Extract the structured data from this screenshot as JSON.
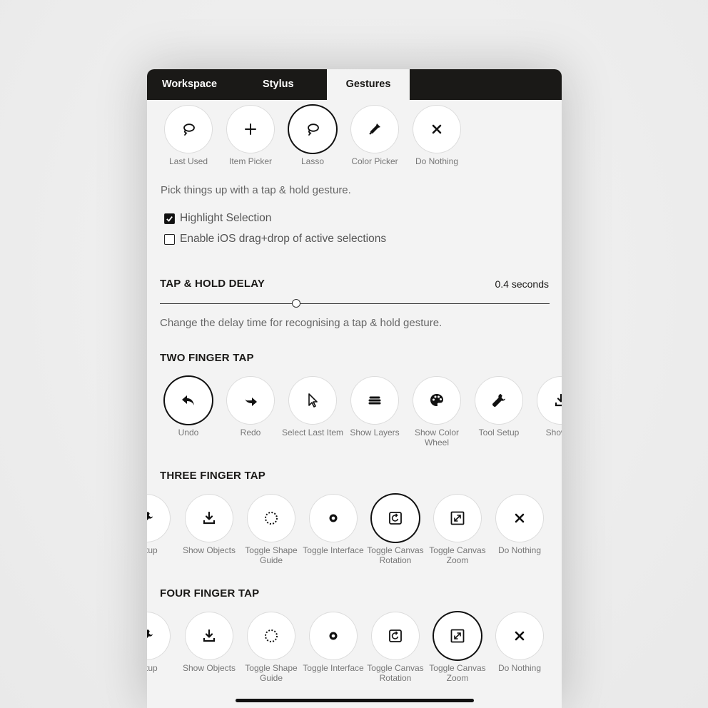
{
  "tabs": [
    "Workspace",
    "Stylus",
    "Gestures"
  ],
  "active_tab": "Gestures",
  "top_options": [
    {
      "label": "Last Used",
      "icon": "lasso-icon",
      "selected": false
    },
    {
      "label": "Item Picker",
      "icon": "plus-icon",
      "selected": false
    },
    {
      "label": "Lasso",
      "icon": "lasso-icon",
      "selected": true
    },
    {
      "label": "Color Picker",
      "icon": "eyedropper-icon",
      "selected": false
    },
    {
      "label": "Do Nothing",
      "icon": "x-icon",
      "selected": false
    }
  ],
  "pick_description": "Pick things up with a tap & hold gesture.",
  "checkboxes": [
    {
      "label": "Highlight Selection",
      "checked": true
    },
    {
      "label": "Enable iOS drag+drop of active selections",
      "checked": false
    }
  ],
  "delay": {
    "title": "TAP & HOLD DELAY",
    "value_text": "0.4 seconds",
    "slider_fraction": 0.35,
    "description": "Change the delay time for recognising a tap & hold gesture."
  },
  "two_finger": {
    "title": "TWO FINGER TAP",
    "options": [
      {
        "label": "Undo",
        "icon": "undo-icon",
        "selected": true
      },
      {
        "label": "Redo",
        "icon": "redo-icon",
        "selected": false
      },
      {
        "label": "Select Last Item",
        "icon": "cursor-icon",
        "selected": false
      },
      {
        "label": "Show Layers",
        "icon": "layers-icon",
        "selected": false
      },
      {
        "label": "Show Color Wheel",
        "icon": "palette-icon",
        "selected": false
      },
      {
        "label": "Tool Setup",
        "icon": "wrench-icon",
        "selected": false
      },
      {
        "label": "Show O",
        "icon": "download-icon",
        "selected": false
      }
    ]
  },
  "three_finger": {
    "title": "THREE FINGER TAP",
    "options": [
      {
        "label": "Setup",
        "icon": "wrench-icon",
        "selected": false
      },
      {
        "label": "Show Objects",
        "icon": "download-icon",
        "selected": false
      },
      {
        "label": "Toggle Shape Guide",
        "icon": "dotted-circle-icon",
        "selected": false
      },
      {
        "label": "Toggle Interface",
        "icon": "dot-icon",
        "selected": false
      },
      {
        "label": "Toggle Canvas Rotation",
        "icon": "rotate-icon",
        "selected": true
      },
      {
        "label": "Toggle Canvas Zoom",
        "icon": "zoom-icon",
        "selected": false
      },
      {
        "label": "Do Nothing",
        "icon": "x-icon",
        "selected": false
      }
    ]
  },
  "four_finger": {
    "title": "FOUR FINGER TAP",
    "options": [
      {
        "label": "Setup",
        "icon": "wrench-icon",
        "selected": false
      },
      {
        "label": "Show Objects",
        "icon": "download-icon",
        "selected": false
      },
      {
        "label": "Toggle Shape Guide",
        "icon": "dotted-circle-icon",
        "selected": false
      },
      {
        "label": "Toggle Interface",
        "icon": "dot-icon",
        "selected": false
      },
      {
        "label": "Toggle Canvas Rotation",
        "icon": "rotate-icon",
        "selected": false
      },
      {
        "label": "Toggle Canvas Zoom",
        "icon": "zoom-icon",
        "selected": true
      },
      {
        "label": "Do Nothing",
        "icon": "x-icon",
        "selected": false
      }
    ]
  }
}
